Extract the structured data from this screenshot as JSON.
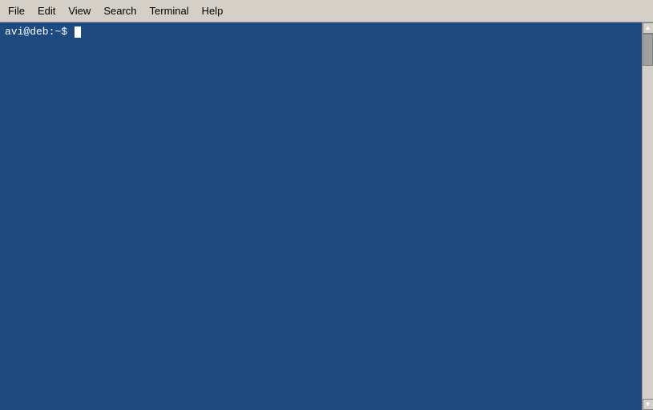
{
  "menubar": {
    "items": [
      {
        "label": "File",
        "id": "file"
      },
      {
        "label": "Edit",
        "id": "edit"
      },
      {
        "label": "View",
        "id": "view"
      },
      {
        "label": "Search",
        "id": "search"
      },
      {
        "label": "Terminal",
        "id": "terminal"
      },
      {
        "label": "Help",
        "id": "help"
      }
    ]
  },
  "terminal": {
    "background_color": "#1e4a80",
    "prompt": "avi@deb:~$ "
  }
}
